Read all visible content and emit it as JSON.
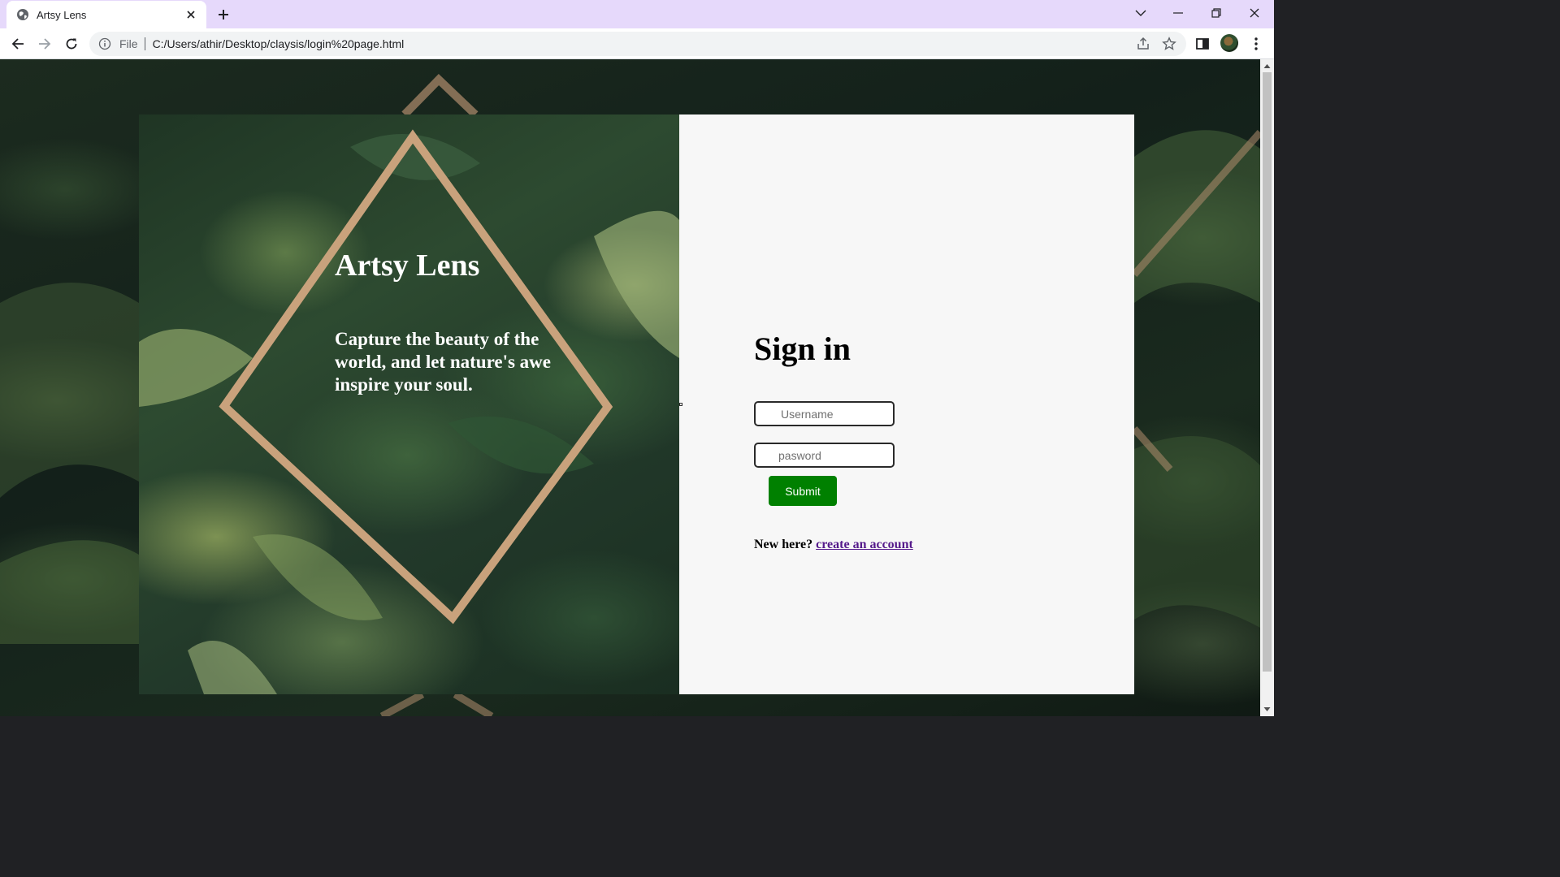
{
  "browser": {
    "tab_title": "Artsy Lens",
    "address_scheme": "File",
    "address_url": "C:/Users/athir/Desktop/claysis/login%20page.html"
  },
  "hero": {
    "title": "Artsy Lens",
    "tagline": "Capture the beauty of the world, and let nature's awe inspire your soul."
  },
  "signin": {
    "heading": "Sign in",
    "username_placeholder": "Username",
    "password_placeholder": "pasword",
    "submit_label": "Submit",
    "new_here": "New here?",
    "create_account": "create an account"
  },
  "colors": {
    "tabbar": "#e6d9fb",
    "submit_green": "#008000",
    "link_visited": "#551a8b",
    "panel": "#f7f7f7",
    "frame_gold": "#c9a27c"
  }
}
